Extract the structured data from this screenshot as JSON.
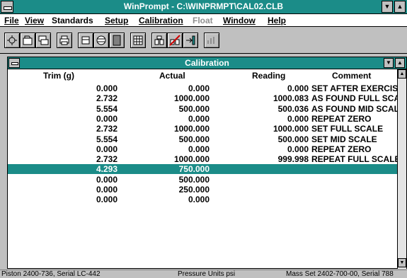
{
  "app": {
    "title": "WinPrompt - C:\\WINPRMPT\\CAL02.CLB"
  },
  "menu": {
    "items": [
      {
        "label": "File",
        "enabled": true
      },
      {
        "label": "View",
        "enabled": true
      },
      {
        "label": "Standards",
        "enabled": true
      },
      {
        "label": "Setup",
        "enabled": true
      },
      {
        "label": "Calibration",
        "enabled": true
      },
      {
        "label": "Float",
        "enabled": false
      },
      {
        "label": "Window",
        "enabled": true
      },
      {
        "label": "Help",
        "enabled": true
      }
    ]
  },
  "toolbar": {
    "icons": [
      "new-icon",
      "open-icon",
      "save-icon",
      "print-icon",
      "piston-icon",
      "mass-set-icon",
      "gauge-icon",
      "calculator-icon",
      "weights-icon",
      "no-weights-icon",
      "transfer-icon",
      "float-icon"
    ]
  },
  "calibration": {
    "title": "Calibration",
    "columns": [
      "Trim (g)",
      "Actual",
      "Reading",
      "Comment"
    ],
    "rows": [
      {
        "trim": "0.000",
        "actual": "0.000",
        "reading": "0.000",
        "comment": "SET AFTER EXERCISE"
      },
      {
        "trim": "2.732",
        "actual": "1000.000",
        "reading": "1000.083",
        "comment": "AS FOUND FULL SCALE"
      },
      {
        "trim": "5.554",
        "actual": "500.000",
        "reading": "500.036",
        "comment": "AS FOUND MID SCALE"
      },
      {
        "trim": "0.000",
        "actual": "0.000",
        "reading": "0.000",
        "comment": "REPEAT ZERO"
      },
      {
        "trim": "2.732",
        "actual": "1000.000",
        "reading": "1000.000",
        "comment": "SET FULL SCALE"
      },
      {
        "trim": "5.554",
        "actual": "500.000",
        "reading": "500.000",
        "comment": "SET MID SCALE"
      },
      {
        "trim": "0.000",
        "actual": "0.000",
        "reading": "0.000",
        "comment": "REPEAT ZERO"
      },
      {
        "trim": "2.732",
        "actual": "1000.000",
        "reading": "999.998",
        "comment": "REPEAT FULL SCALE"
      },
      {
        "trim": "4.293",
        "actual": "750.000",
        "reading": "",
        "comment": "",
        "selected": true
      },
      {
        "trim": "0.000",
        "actual": "500.000",
        "reading": "",
        "comment": ""
      },
      {
        "trim": "0.000",
        "actual": "250.000",
        "reading": "",
        "comment": ""
      },
      {
        "trim": "0.000",
        "actual": "0.000",
        "reading": "",
        "comment": ""
      }
    ]
  },
  "status": {
    "piston": "Piston 2400-736, Serial LC-442",
    "units": "Pressure Units psi",
    "mass_set": "Mass Set 2402-700-00, Serial 788"
  },
  "colors": {
    "title_bar": "#1b8c88",
    "selection": "#1b8c88"
  }
}
